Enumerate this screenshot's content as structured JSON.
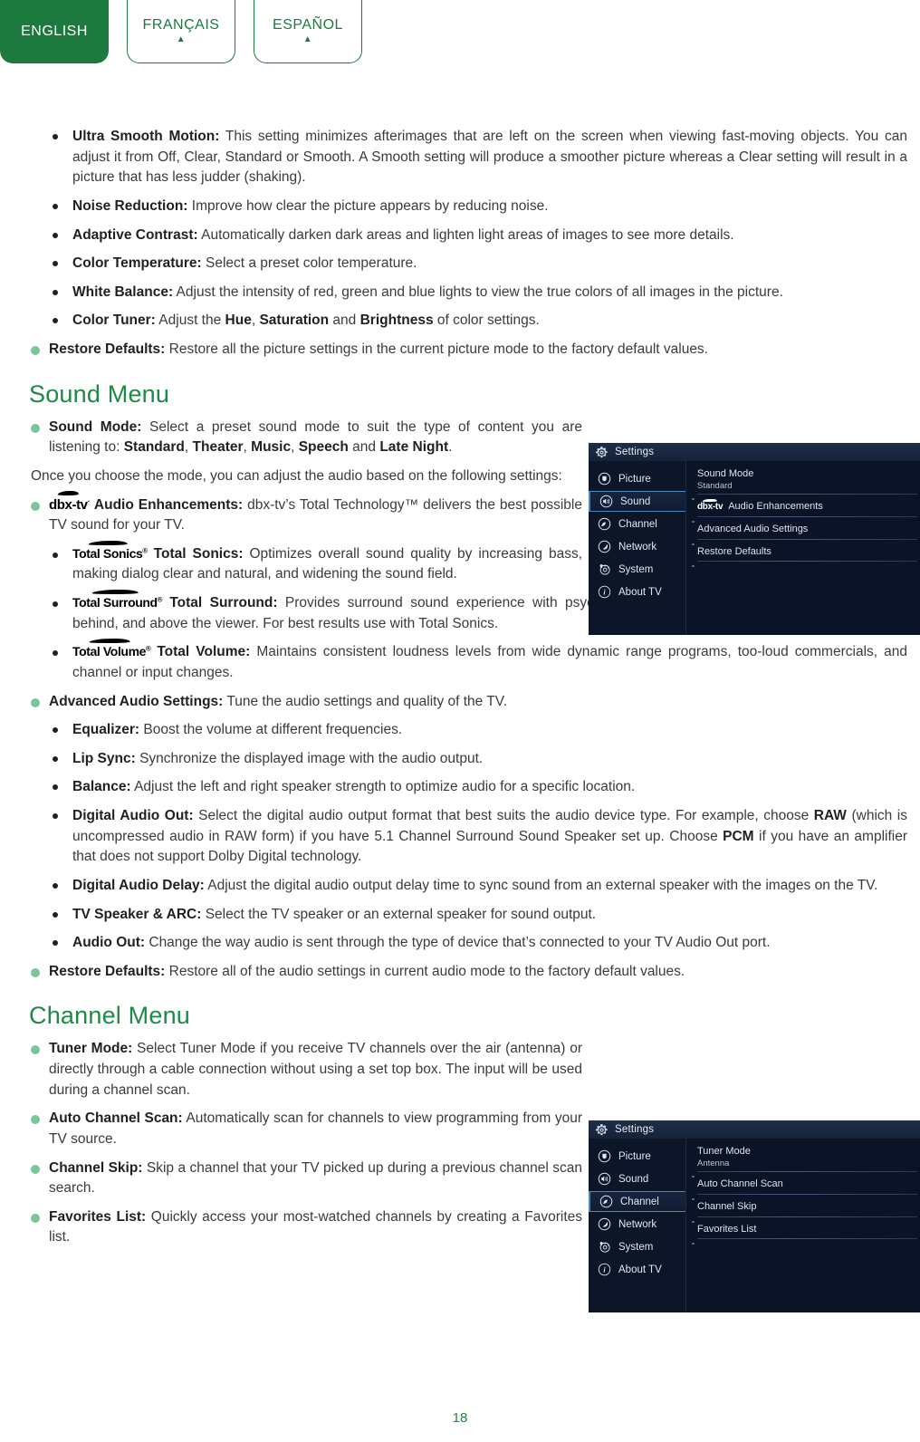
{
  "language_tabs": [
    {
      "label": "ENGLISH",
      "active": true,
      "caret": ""
    },
    {
      "label": "FRANÇAIS",
      "active": false,
      "caret": "▲"
    },
    {
      "label": "ESPAÑOL",
      "active": false,
      "caret": "▲"
    }
  ],
  "picture_section": {
    "items": [
      {
        "term": "Ultra Smooth Motion:",
        "desc": " This setting minimizes afterimages that are left on the screen when viewing fast-moving objects. You can adjust it from Off, Clear, Standard or Smooth. A Smooth setting will produce a smoother picture whereas a Clear setting will result in a picture that has less judder (shaking)."
      },
      {
        "term": "Noise Reduction:",
        "desc": " Improve how clear the picture appears by reducing noise."
      },
      {
        "term": "Adaptive Contrast:",
        "desc": " Automatically darken dark areas and lighten light areas of images to see more details."
      },
      {
        "term": "Color Temperature:",
        "desc": " Select a preset color temperature."
      },
      {
        "term": "White Balance:",
        "desc": " Adjust the intensity of red, green and blue lights to view the true colors of all images in the picture."
      }
    ],
    "color_tuner": {
      "term": "Color Tuner:",
      "part1": " Adjust the ",
      "hue": "Hue",
      "part2": ", ",
      "saturation": "Saturation",
      "part3": " and ",
      "brightness": "Brightness",
      "part4": " of color settings."
    },
    "restore_defaults": {
      "term": "Restore Defaults:",
      "desc": " Restore all the picture settings in the current picture mode to the factory default values."
    }
  },
  "sound_section": {
    "title": "Sound Menu",
    "sound_mode": {
      "term": "Sound Mode:",
      "part1": " Select a preset sound mode to suit the type of content you are listening to: ",
      "modes": [
        "Standard",
        "Theater",
        "Music",
        "Speech",
        "Late Night"
      ],
      "sep": ", ",
      "conj": " and ",
      "end": "."
    },
    "intro_paragraph": "Once you choose the mode, you can adjust the audio based on the following settings:",
    "audio_enhancements": {
      "logo": "dbx-tv",
      "logo_mark": "·",
      "term": "Audio Enhancements:",
      "desc": " dbx-tv’s Total Technology™ delivers the best possible TV sound for your TV."
    },
    "sub_items": [
      {
        "logo": "Total Sonics",
        "logo_mark": "®",
        "term": "Total Sonics:",
        "desc": " Optimizes overall sound quality by increasing bass, making dialog clear and natural, and widening the sound field."
      },
      {
        "logo": "Total Surround",
        "logo_mark": "®",
        "term": "Total Surround:",
        "desc": " Provides surround sound experience with psycho-acoustic processing to place sounds beside, behind, and above the viewer. For best results use with Total Sonics."
      },
      {
        "logo": "Total Volume",
        "logo_mark": "®",
        "term": "Total Volume:",
        "desc": " Maintains consistent loudness levels from wide dynamic range programs, too-loud commercials, and channel or input changes."
      }
    ],
    "advanced": {
      "term": "Advanced Audio Settings:",
      "desc": " Tune the audio settings and quality of the TV."
    },
    "advanced_items": [
      {
        "term": "Equalizer:",
        "desc": " Boost the volume at different frequencies."
      },
      {
        "term": "Lip Sync:",
        "desc": " Synchronize the displayed image with the audio output."
      },
      {
        "term": "Balance:",
        "desc": " Adjust the left and right speaker strength to optimize audio for a specific location."
      }
    ],
    "digital_audio_out": {
      "term": "Digital Audio Out:",
      "part1": " Select the digital audio output format that best suits the audio device type. For example, choose ",
      "raw": "RAW",
      "part2": " (which is uncompressed audio in RAW form) if you have 5.1 Channel Surround Sound Speaker set up. Choose ",
      "pcm": "PCM",
      "part3": " if you have an amplifier that does not support Dolby Digital technology."
    },
    "advanced_items_2": [
      {
        "term": "Digital Audio Delay:",
        "desc": " Adjust the digital audio output delay time to sync sound from an external speaker with the images on the TV."
      },
      {
        "term": "TV Speaker & ARC:",
        "desc": " Select the TV speaker or an external speaker for sound output."
      },
      {
        "term": "Audio Out:",
        "desc": " Change the way audio is sent through the type of device that’s connected to your TV Audio Out port."
      }
    ],
    "restore_defaults": {
      "term": "Restore Defaults:",
      "desc": " Restore all of the audio settings in current audio mode to the factory default values."
    }
  },
  "channel_section": {
    "title": "Channel Menu",
    "items": [
      {
        "term": "Tuner Mode:",
        "desc": " Select Tuner Mode if you receive TV channels over the air (antenna) or directly through a cable connection without using a set top box. The input will be used during a channel scan."
      },
      {
        "term": "Auto Channel Scan:",
        "desc": " Automatically scan for channels to view programming from your TV source."
      },
      {
        "term": "Channel Skip:",
        "desc": " Skip a channel that your TV picked up during a previous channel scan search."
      },
      {
        "term": "Favorites List:",
        "desc": " Quickly access your most-watched channels by creating a Favorites list."
      }
    ]
  },
  "tv_sound_panel": {
    "title": "Settings",
    "sidebar": [
      {
        "label": "Picture",
        "icon": "picture-icon",
        "selected": false
      },
      {
        "label": "Sound",
        "icon": "speaker-icon",
        "selected": true
      },
      {
        "label": "Channel",
        "icon": "satellite-icon",
        "selected": false
      },
      {
        "label": "Network",
        "icon": "globe-icon",
        "selected": false
      },
      {
        "label": "System",
        "icon": "gear-icon",
        "selected": false
      },
      {
        "label": "About TV",
        "icon": "info-icon",
        "selected": false
      }
    ],
    "rows": [
      {
        "label": "Sound Mode",
        "value": "Standard",
        "logo": ""
      },
      {
        "label": "Audio Enhancements",
        "value": "",
        "logo": "dbx-tv"
      },
      {
        "label": "Advanced Audio Settings",
        "value": "",
        "logo": ""
      },
      {
        "label": "Restore Defaults",
        "value": "",
        "logo": ""
      }
    ]
  },
  "tv_channel_panel": {
    "title": "Settings",
    "sidebar": [
      {
        "label": "Picture",
        "icon": "picture-icon",
        "selected": false
      },
      {
        "label": "Sound",
        "icon": "speaker-icon",
        "selected": false
      },
      {
        "label": "Channel",
        "icon": "satellite-icon",
        "selected": true
      },
      {
        "label": "Network",
        "icon": "globe-icon",
        "selected": false
      },
      {
        "label": "System",
        "icon": "gear-icon",
        "selected": false
      },
      {
        "label": "About TV",
        "icon": "info-icon",
        "selected": false
      }
    ],
    "rows": [
      {
        "label": "Tuner Mode",
        "value": "Antenna",
        "logo": ""
      },
      {
        "label": "Auto Channel Scan",
        "value": "",
        "logo": ""
      },
      {
        "label": "Channel Skip",
        "value": "",
        "logo": ""
      },
      {
        "label": "Favorites List",
        "value": "",
        "logo": ""
      }
    ]
  },
  "footer": {
    "page_number": "18"
  },
  "colors": {
    "brand_green": "#1d7a3e",
    "heading_green": "#1d8a45",
    "bullet_green": "#7cc49a",
    "panel_bg": "#0b1426",
    "panel_accent": "#4a86b8"
  }
}
